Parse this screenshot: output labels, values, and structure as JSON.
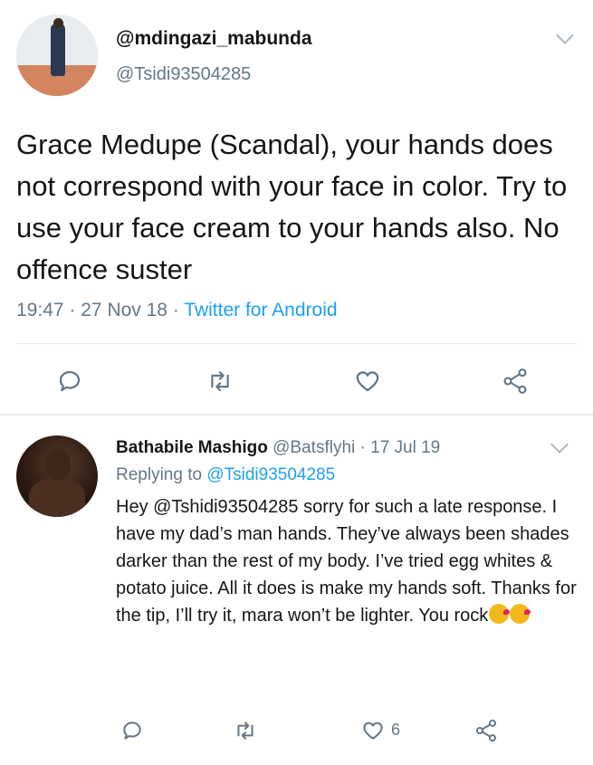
{
  "tweet": {
    "display_name": "@mdingazi_mabunda",
    "handle": "@Tsidi93504285",
    "text": "Grace Medupe (Scandal), your hands does not correspond with your face in color. Try to use your face cream to your hands also. No offence suster",
    "time": "19:47",
    "date": "27 Nov 18",
    "separator": "·",
    "source": "Twitter for Android",
    "actions": [
      "reply-icon",
      "retweet-icon",
      "like-icon",
      "share-icon"
    ]
  },
  "reply": {
    "name": "Bathabile Mashigo",
    "handle": "@Batsflyhi",
    "separator": "·",
    "date": "17 Jul 19",
    "replying_label": "Replying to",
    "replying_to": "@Tsidi93504285",
    "text": "Hey @Tshidi93504285 sorry for such a late response. I have my dad’s man hands. They’ve always been shades darker than the rest of my body. I’ve tried egg whites & potato juice. All it does is make my hands soft. Thanks for the tip, I’ll try it, mara won’t be lighter. You rock",
    "emoji": [
      "kissing-face-emoji",
      "kissing-face-emoji"
    ],
    "like_count": "6",
    "actions": [
      "reply-icon",
      "retweet-icon",
      "like-icon",
      "share-icon"
    ]
  },
  "colors": {
    "text": "#14171a",
    "secondary": "#657786",
    "accent": "#1da1f2",
    "divider": "#e6ecf0"
  }
}
